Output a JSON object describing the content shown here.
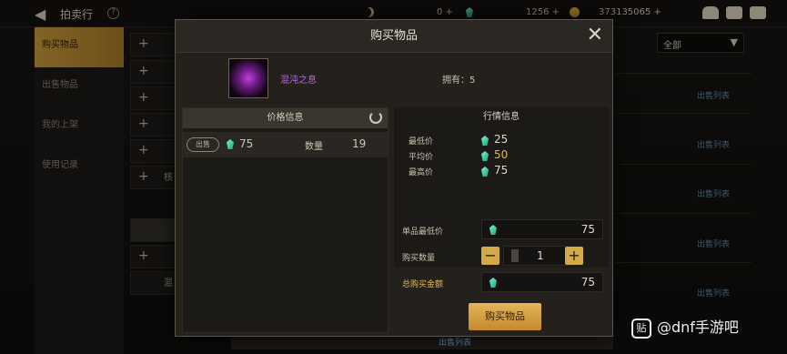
{
  "header": {
    "back_icon": "back-arrow-icon",
    "title": "拍卖行",
    "help": "?",
    "currencies": [
      {
        "name": "moon-currency",
        "value": "0"
      },
      {
        "name": "gem-currency",
        "value": "1256"
      },
      {
        "name": "gold-currency",
        "value": "373135065"
      }
    ]
  },
  "nav": {
    "items": [
      {
        "label": "购买物品",
        "active": true
      },
      {
        "label": "出售物品",
        "active": false
      },
      {
        "label": "我的上架",
        "active": false
      },
      {
        "label": "使用记录",
        "active": false
      }
    ]
  },
  "background": {
    "filter_selected": "全部",
    "sell_list_link": "出售列表",
    "bg_row_text": "核",
    "bg_row_text2": "混"
  },
  "modal": {
    "title": "购买物品",
    "item_name": "混沌之息",
    "owned": "拥有：5",
    "price_panel": {
      "header": "价格信息",
      "listing": {
        "tag": "出售",
        "price": "75",
        "qty_label": "数量",
        "qty": "19"
      }
    },
    "market_panel": {
      "header": "行情信息",
      "stats": [
        {
          "label": "最低价",
          "value": "25"
        },
        {
          "label": "平均价",
          "value": "50"
        },
        {
          "label": "最高价",
          "value": "75"
        }
      ]
    },
    "form": {
      "unit_price_label": "单品最低价",
      "unit_price": "75",
      "quantity_label": "购买数量",
      "quantity": "1",
      "minus": "−",
      "plus": "+",
      "total_label": "总购买金额",
      "total": "75"
    },
    "buy_button": "购买物品"
  },
  "watermark": {
    "icon_text": "贴",
    "text": "@dnf手游吧"
  },
  "colors": {
    "accent_gold": "#d3a94a",
    "item_purple": "#b06ad6",
    "gem_green": "#19a67f",
    "link_blue": "#5d87a8"
  }
}
